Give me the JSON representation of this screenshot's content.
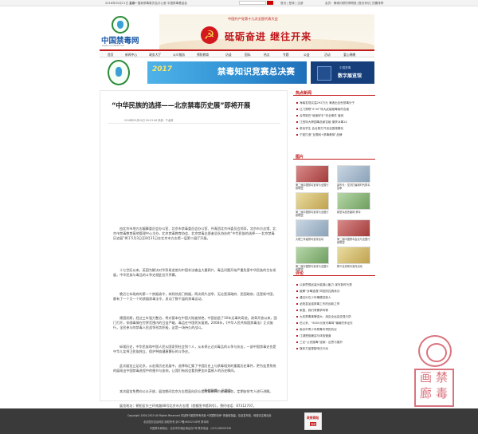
{
  "topbar": {
    "date": "2018年05月21日 星期一",
    "links": "主办：国家禁毒委员会办公室  中国禁毒基金会",
    "right_links": "首页 | 登录 | 注册",
    "right": "会员：静候约顾的博物馆  [首页采访] 顶置排称"
  },
  "header": {
    "logo_text": "中国禁毒网",
    "logo_sub": "www.nncc626.com",
    "banner_congress": "中国共产党第十九次全国代表大会",
    "banner_slogan": "砥砺奋进 继往开来"
  },
  "nav": [
    "首页",
    "新闻中心",
    "政务大厅",
    "公众服务",
    "预防教育",
    "访谈",
    "国际",
    "热点",
    "专题",
    "公益",
    "活动",
    "爱心捐赠"
  ],
  "strip": {
    "year": "2017",
    "title": "禁毒知识竞赛总决赛",
    "hall_org": "中国禁毒",
    "hall": "数字展览馆"
  },
  "article": {
    "title": "“中华民族的选择——北京禁毒历史展”即将开展",
    "meta": "2018年05月04日  09:23:46     来源：千龙网",
    "paragraphs": [
      "由北京市地方志编纂委员会办公室、北京市禁毒委员会办公室、共青团北京市委员会领导，北京市方志馆、北京市禁毒教育基地管理中心主办，北京禁毒教育协会、北京禁毒志愿者总队协办的“中华民族的选择——北京禁毒历史展”将于5月3日至8月31日在北京市方志馆一层第二展厅开展。",
      "十七世纪以来，英国为解决对华贸易逆差向中国非法输出大量鸦片，毒品问题开始严重危害中华民族的生存发展，中华民族与毒品的斗争史就此拉开序幕。",
      "晚近七年政府的第一个禁烟谕令，林则徐虎门销烟，两次鸦片战争，无论是清政府、民国政府，还是新中国，都有了一个又一个的禁烟禁毒法令，发动了数千届的禁毒运动。",
      "建国初期，经过三年强力整治，将对基本在中国大陆被禁绝，中国创造了30年无毒的奇迹。改革开放以来，国门打开，伴随毒情在世界范围内的日益严峻，毒品在中国死灰复燃。2008年，《中华人民共和国禁毒法》正式施行，全民参与的禁毒人民战争形势积极，这是一场持久的战斗。",
      "纵观历史，中华民族和中国人民从国家到社会到个人，从未停止过对毒品的斗争与抗击，一部中国禁毒史也是中华儿女捍卫民族独立、保护种族健康繁衍的斗争史。",
      "此次展览立足北京，从宏观历史发展中，选择和汇集了中国历史上与禁毒相关的重要历史事件，更为连贯系统的展现出中国禁毒进程中的细节与血肉，让我们有机会看到更加丰富感人的历史瞬间。",
      "本次展览免费向公众开放，展览期间北京方志馆面向民众提供集体预约参观服务，定期安排专人进行讲解。",
      "展览地址：朝阳区东三环南路88号北京市方志馆（首都图书馆四号）。预约电话：87312707。"
    ],
    "editor": "责任编辑：  吕爱玲"
  },
  "sidebar": {
    "hot_title": "热点新闻",
    "hot": [
      "海南发现实温292万元 海洛出全世禁毒分子",
      "辽门禁联“6·30”特大武装贩毒案件告破",
      "合同制在“破案好手”安全事件 值班",
      "江西特大跨国毒品案告破 缴获冰毒14",
      "参加学生 会合数打开创全国规模化",
      "宁夏打造“互联网+禁毒教育”品牌"
    ],
    "pic_title": "图片",
    "pics": [
      "第二届中国禁毒宣传与全国行政联盟",
      "副市长：坚决打赢新时代禁毒战争",
      "第二届中国禁毒宣传与全国行政联盟",
      "新型毒品伤害网 禁毒",
      "大理三年级禁毒宣传活动",
      "第二届中国禁毒会议与全国行政联盟",
      "第二届中国禁毒宣传与全国行政联盟",
      "群众支持禁毒宣传活动"
    ],
    "comment_title": "评论",
    "comments": [
      "以新思想武装头脑凝心聚力 谋写新时代禁",
      "破解“涉毒逃逸”风险防控具体办",
      "遇见乐在少年毒模范新人",
      "泌阳县加强禁毒工作的创新之举",
      "家庭，我们有需求吗等",
      "大庆禁毒事警强大：用应全运会坚强与防",
      "伯父来，“6000元就可毒驾”骗局的来龙去",
      "南京市青少年禁毒专项的抗议",
      "江湖是极兼容与体验管道",
      "三论“公安疑毒”谜案：反思与展开",
      "媒体方量是影响日行动"
    ]
  },
  "seal": {
    "chars": [
      "禁",
      "毒",
      "画",
      "廊"
    ]
  },
  "footer": {
    "line1": "Copyright 2004-2015 All Rights Reserved 本站所刊载的所有作品 *中国禁毒网* 的版权保留。信息发布前，转载请注明出处",
    "line2": "北京国元信息科技 版权所有  京ICP备06002348号  禁毒网",
    "line3": "中国禁毒网地址：北京市东城区海运仓2号   联系电话：(010) 88000336",
    "badge_top": "政府网站",
    "badge_bottom": "找错"
  },
  "colors": {
    "accent": "#c21a1a",
    "brand_blue": "#1d5aa8"
  }
}
